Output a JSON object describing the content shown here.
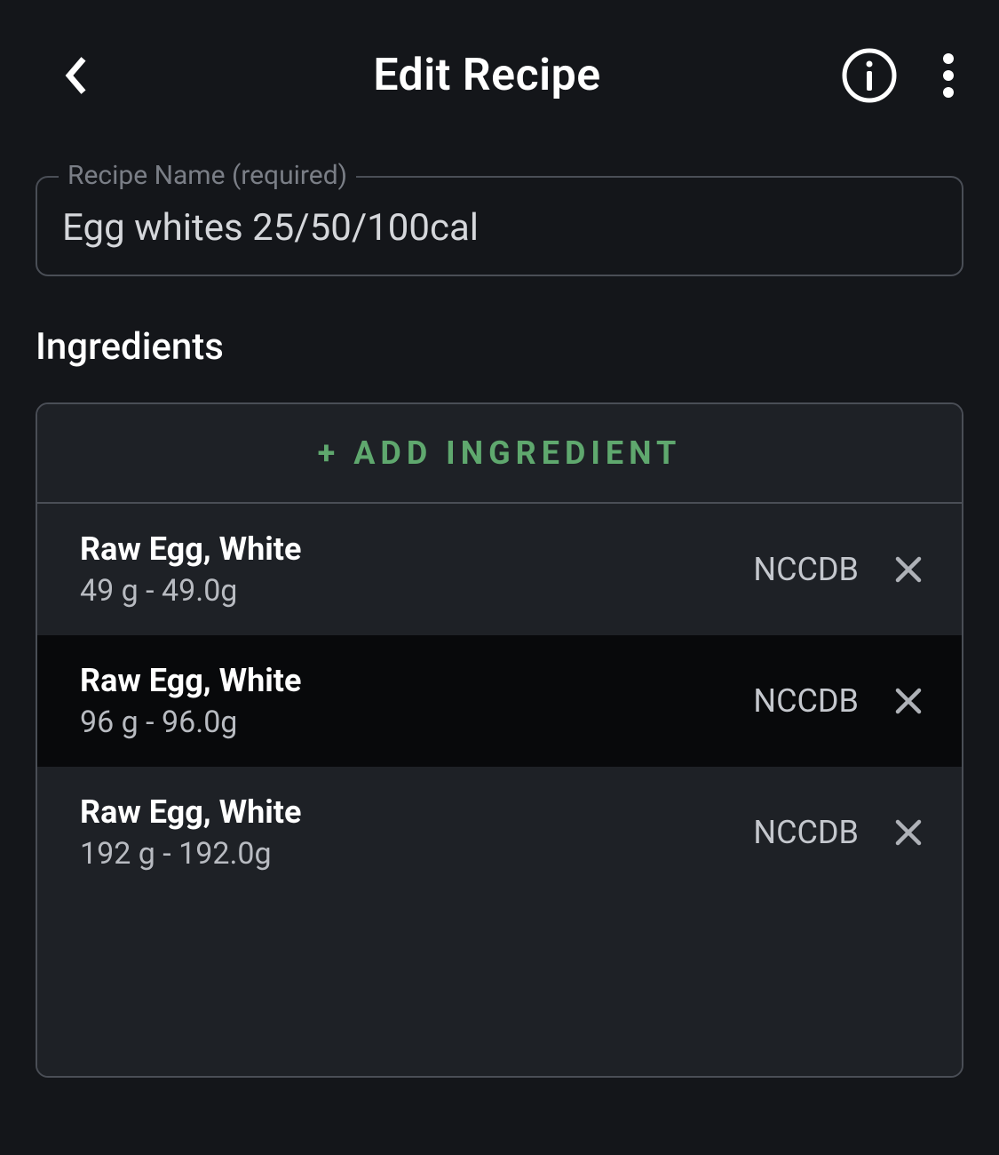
{
  "header": {
    "title": "Edit Recipe"
  },
  "recipe_name": {
    "label": "Recipe Name (required)",
    "value": "Egg whites 25/50/100cal"
  },
  "ingredients_section": {
    "title": "Ingredients",
    "add_label": "+ ADD INGREDIENT"
  },
  "ingredients": [
    {
      "name": "Raw Egg, White",
      "qty": "49 g - 49.0g",
      "source": "NCCDB"
    },
    {
      "name": "Raw Egg, White",
      "qty": "96 g - 96.0g",
      "source": "NCCDB"
    },
    {
      "name": "Raw Egg, White",
      "qty": "192 g - 192.0g",
      "source": "NCCDB"
    }
  ]
}
